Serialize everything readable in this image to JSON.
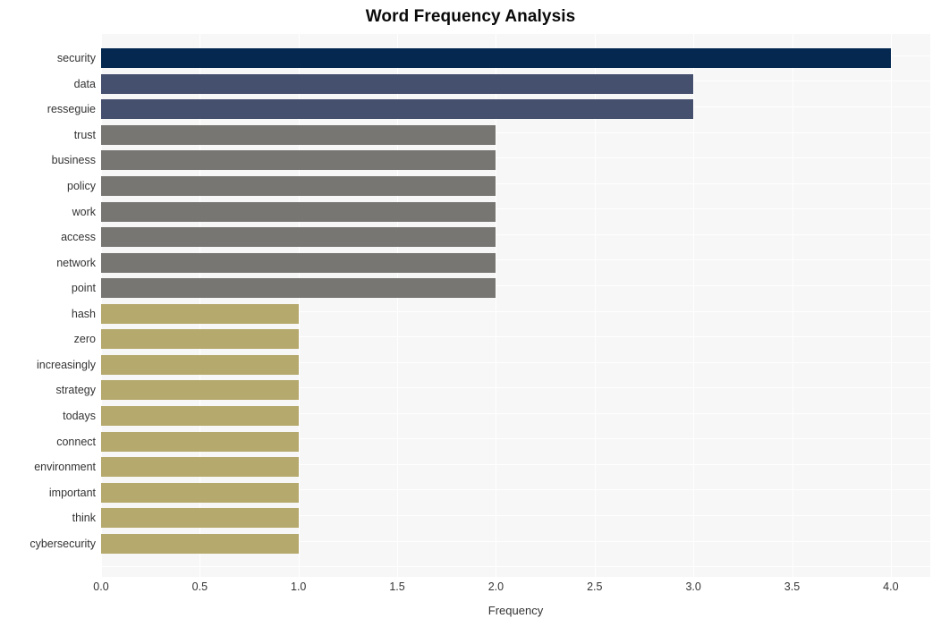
{
  "chart_data": {
    "type": "bar",
    "orientation": "horizontal",
    "title": "Word Frequency Analysis",
    "xlabel": "Frequency",
    "ylabel": "",
    "xlim": [
      0.0,
      4.2
    ],
    "ylim": [
      0,
      20
    ],
    "grid": true,
    "legend": null,
    "x_tick_labels": [
      "0.0",
      "0.5",
      "1.0",
      "1.5",
      "2.0",
      "2.5",
      "3.0",
      "3.5",
      "4.0"
    ],
    "x_tick_values": [
      0.0,
      0.5,
      1.0,
      1.5,
      2.0,
      2.5,
      3.0,
      3.5,
      4.0
    ],
    "categories": [
      "security",
      "data",
      "resseguie",
      "trust",
      "business",
      "policy",
      "work",
      "access",
      "network",
      "point",
      "hash",
      "zero",
      "increasingly",
      "strategy",
      "todays",
      "connect",
      "environment",
      "important",
      "think",
      "cybersecurity"
    ],
    "values": [
      4,
      3,
      3,
      2,
      2,
      2,
      2,
      2,
      2,
      2,
      1,
      1,
      1,
      1,
      1,
      1,
      1,
      1,
      1,
      1
    ],
    "bar_colors": [
      "#04284f",
      "#454f6e",
      "#454f6e",
      "#787672",
      "#787672",
      "#787672",
      "#787672",
      "#787672",
      "#787672",
      "#787672",
      "#b6a96d",
      "#b6a96d",
      "#b6a96d",
      "#b6a96d",
      "#b6a96d",
      "#b6a96d",
      "#b6a96d",
      "#b6a96d",
      "#b6a96d",
      "#b6a96d"
    ]
  },
  "style": {
    "plot_background": "#f7f7f8",
    "figure_background": "#ffffff",
    "gridline_color": "#ffffff",
    "text_color": "#333333",
    "title_color": "#0a0a0a"
  }
}
